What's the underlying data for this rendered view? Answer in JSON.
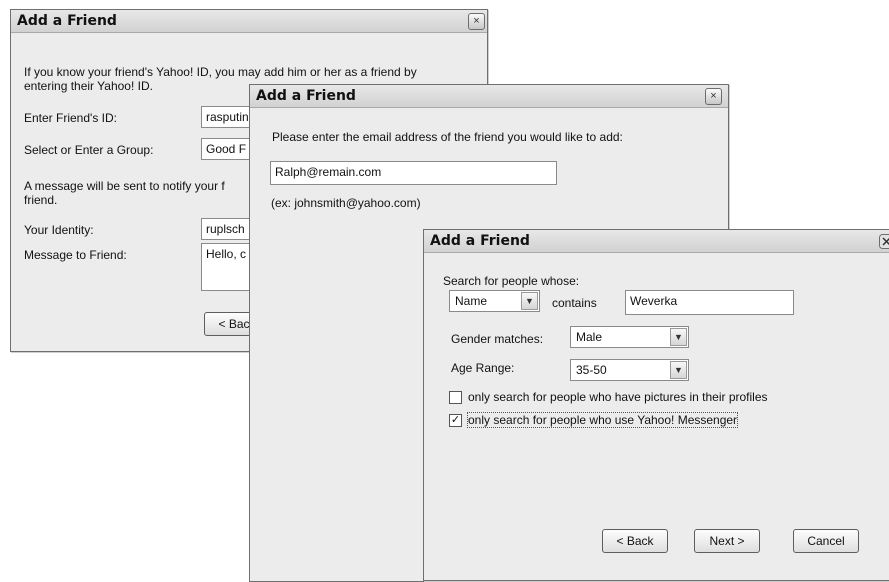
{
  "dialog1": {
    "title": "Add a Friend",
    "close_glyph": "×",
    "intro_line1": "If you know your friend's Yahoo! ID, you may add him or her as a friend by",
    "intro_line2": "entering their Yahoo! ID.",
    "friend_id_label": "Enter Friend's ID:",
    "friend_id_value": "rasputin",
    "group_label": "Select or Enter a Group:",
    "group_value": "Good F",
    "notify_line1": "A message will be sent to notify your f",
    "notify_line2": "friend.",
    "identity_label": "Your Identity:",
    "identity_value": "ruplsch",
    "message_label": "Message to Friend:",
    "message_value": "Hello, c",
    "back_button": "< Bac"
  },
  "dialog2": {
    "title": "Add a Friend",
    "close_glyph": "×",
    "prompt": "Please enter the email address of the friend you would like to add:",
    "email_value": "Ralph@remain.com",
    "example": "(ex: johnsmith@yahoo.com)"
  },
  "dialog3": {
    "title": "Add a Friend",
    "search_label": "Search for people whose:",
    "field_select_value": "Name",
    "contains_label": "contains",
    "search_value": "Weverka",
    "gender_label": "Gender matches:",
    "gender_value": "Male",
    "age_label": "Age Range:",
    "age_value": "35-50",
    "pictures_option": "only search for people who have pictures in their profiles",
    "pictures_checked": false,
    "messenger_option": "only search for people who use Yahoo! Messenger",
    "messenger_checked": true,
    "check_glyph": "✓",
    "back_button": "< Back",
    "next_button": "Next >",
    "cancel_button": "Cancel"
  }
}
